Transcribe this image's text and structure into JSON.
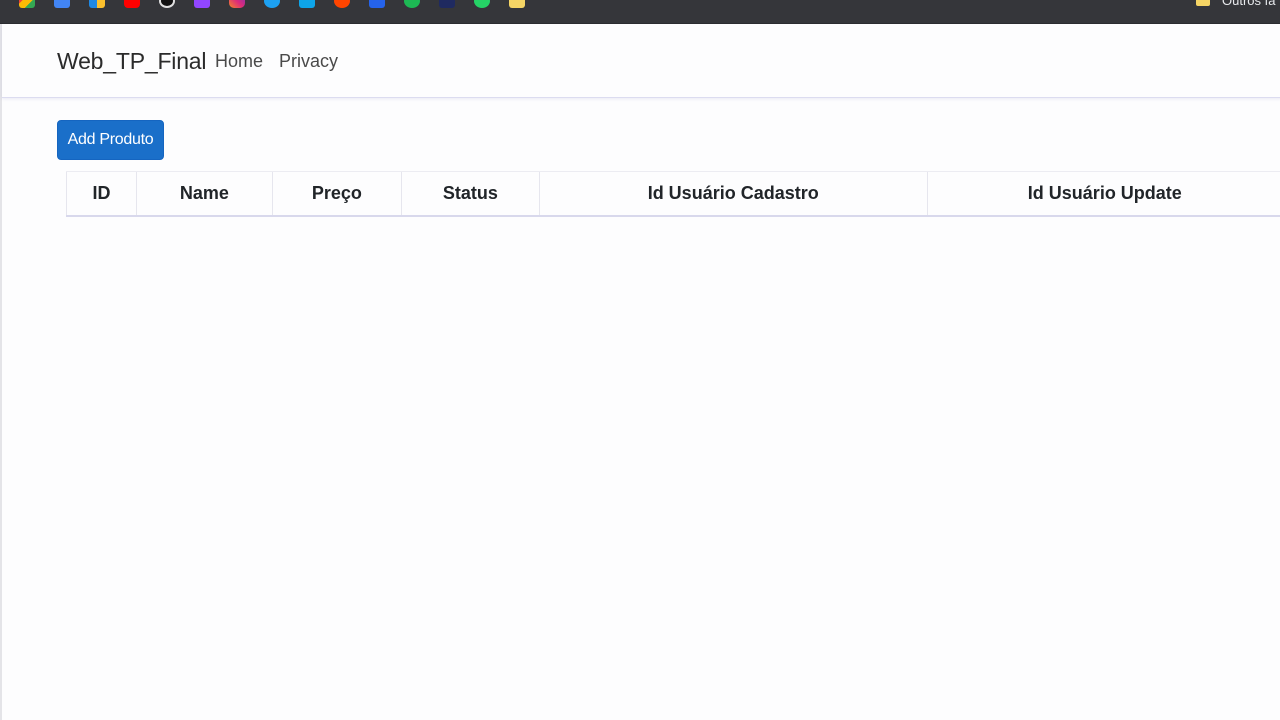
{
  "browser": {
    "bookmarks": [
      {
        "icon": "gmail-icon"
      },
      {
        "icon": "calendar-icon"
      },
      {
        "icon": "drive-icon"
      },
      {
        "icon": "youtube-icon"
      },
      {
        "icon": "github-icon"
      },
      {
        "icon": "twitch-icon"
      },
      {
        "icon": "instagram-icon"
      },
      {
        "icon": "twitter-icon"
      },
      {
        "icon": "trello-icon"
      },
      {
        "icon": "reddit-icon"
      },
      {
        "icon": "translate-icon"
      },
      {
        "icon": "spotify-icon"
      },
      {
        "icon": "nhl-icon"
      },
      {
        "icon": "whatsapp-icon"
      },
      {
        "icon": "folder-icon"
      }
    ],
    "other_bookmarks_label": "Outros fa"
  },
  "navbar": {
    "brand": "Web_TP_Final",
    "links": [
      "Home",
      "Privacy"
    ]
  },
  "main": {
    "add_button_label": "Add Produto",
    "table": {
      "headers": [
        "ID",
        "Name",
        "Preço",
        "Status",
        "Id Usuário Cadastro",
        "Id Usuário Update"
      ],
      "rows": []
    }
  },
  "colors": {
    "primary": "#1a6fc9",
    "page_background": "#fdfdfe",
    "bookmarks_bar": "#35363a"
  }
}
